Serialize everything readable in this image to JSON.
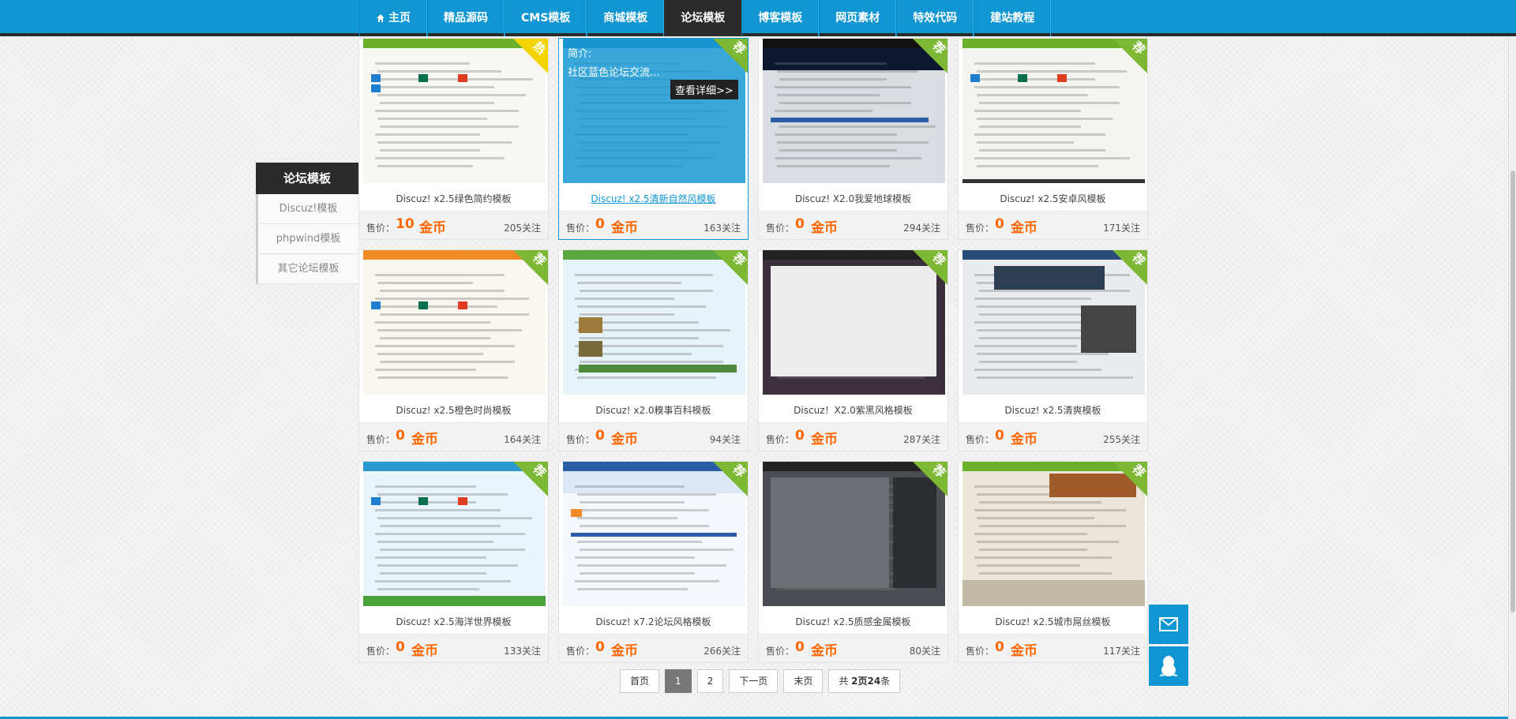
{
  "nav": {
    "items": [
      {
        "label": "主页",
        "home": true
      },
      {
        "label": "精品源码"
      },
      {
        "label": "CMS模板"
      },
      {
        "label": "商城模板"
      },
      {
        "label": "论坛模板",
        "active": true
      },
      {
        "label": "博客模板"
      },
      {
        "label": "网页素材"
      },
      {
        "label": "特效代码"
      },
      {
        "label": "建站教程"
      }
    ]
  },
  "sidebar": {
    "title": "论坛模板",
    "links": [
      "Discuz!模板",
      "phpwind模板",
      "其它论坛模板"
    ]
  },
  "labels": {
    "price": "售价：",
    "unit": "金币",
    "follow_suffix": "关注"
  },
  "products": [
    {
      "title": "Discuz! x2.5绿色简约模板",
      "price": "10",
      "follows": "205关注",
      "badge": "热",
      "badge_type": "hot",
      "theme": "green"
    },
    {
      "title": "Discuz! x2.5清新自然风模板",
      "price": "0",
      "follows": "163关注",
      "badge": "荐",
      "badge_type": "rec",
      "theme": "blue",
      "hover": true,
      "intro_label": "简介:",
      "intro": "社区蓝色论坛交流...",
      "detail_button": "查看详细>>"
    },
    {
      "title": "Discuz! X2.0我爱地球模板",
      "price": "0",
      "follows": "294关注",
      "badge": "荐",
      "badge_type": "rec",
      "theme": "earth"
    },
    {
      "title": "Discuz! x2.5安卓风模板",
      "price": "0",
      "follows": "171关注",
      "badge": "荐",
      "badge_type": "rec",
      "theme": "android"
    },
    {
      "title": "Discuz! x2.5橙色时尚模板",
      "price": "0",
      "follows": "164关注",
      "badge": "荐",
      "badge_type": "rec",
      "theme": "orange"
    },
    {
      "title": "Discuz! x2.0糗事百科模板",
      "price": "0",
      "follows": "94关注",
      "badge": "荐",
      "badge_type": "rec",
      "theme": "qiushi"
    },
    {
      "title": "Discuz！X2.0紫黑风格模板",
      "price": "0",
      "follows": "287关注",
      "badge": "荐",
      "badge_type": "rec",
      "theme": "purple"
    },
    {
      "title": "Discuz! x2.5清爽模板",
      "price": "0",
      "follows": "255关注",
      "badge": "荐",
      "badge_type": "rec",
      "theme": "fresh"
    },
    {
      "title": "Discuz! x2.5海洋世界模板",
      "price": "0",
      "follows": "133关注",
      "badge": "荐",
      "badge_type": "rec",
      "theme": "ocean"
    },
    {
      "title": "Discuz! x7.2论坛风格模板",
      "price": "0",
      "follows": "266关注",
      "badge": "荐",
      "badge_type": "rec",
      "theme": "x72"
    },
    {
      "title": "Discuz! x2.5质感金属模板",
      "price": "0",
      "follows": "80关注",
      "badge": "荐",
      "badge_type": "rec",
      "theme": "metal"
    },
    {
      "title": "Discuz! x2.5城市屌丝模板",
      "price": "0",
      "follows": "117关注",
      "badge": "荐",
      "badge_type": "rec",
      "theme": "city"
    }
  ],
  "pagination": {
    "first": "首页",
    "pages": [
      "1",
      "2"
    ],
    "current": "1",
    "next": "下一页",
    "last": "末页",
    "summary_prefix": "共 ",
    "total_pages": "2",
    "summary_mid": "页",
    "total_items": "24",
    "summary_suffix": "条"
  },
  "colors": {
    "brand": "#1096d3",
    "dark": "#2b2b2b",
    "price": "#ff6600",
    "ribbon_rec": "#7cb833",
    "ribbon_hot": "#f3d400"
  },
  "icons": {
    "home": "home-icon",
    "mail": "mail-icon",
    "qq": "qq-penguin-icon"
  }
}
